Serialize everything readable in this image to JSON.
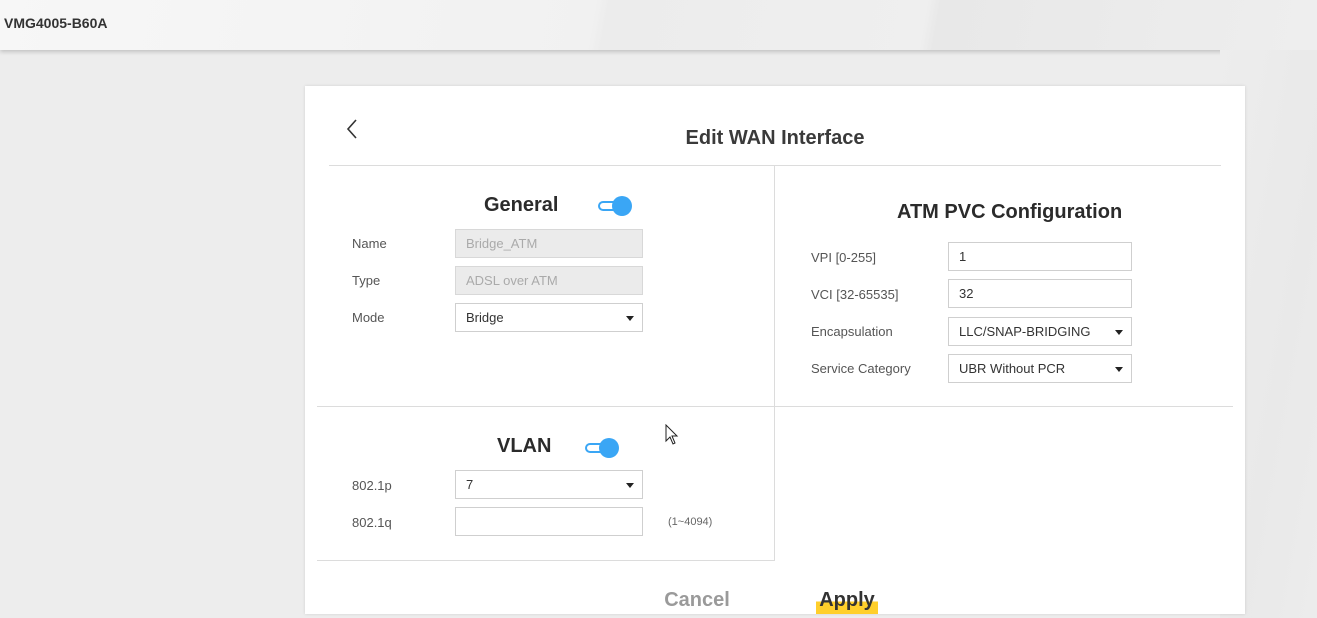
{
  "header": {
    "device_name": "VMG4005-B60A"
  },
  "dialog": {
    "title": "Edit WAN Interface",
    "back_icon": "chevron-left-icon",
    "general": {
      "title": "General",
      "enabled": true,
      "name_label": "Name",
      "name_value": "Bridge_ATM",
      "type_label": "Type",
      "type_value": "ADSL over ATM",
      "mode_label": "Mode",
      "mode_value": "Bridge"
    },
    "atm": {
      "title": "ATM PVC Configuration",
      "vpi_label": "VPI [0-255]",
      "vpi_value": "1",
      "vci_label": "VCI [32-65535]",
      "vci_value": "32",
      "encap_label": "Encapsulation",
      "encap_value": "LLC/SNAP-BRIDGING",
      "service_label": "Service Category",
      "service_value": "UBR Without PCR"
    },
    "vlan": {
      "title": "VLAN",
      "enabled": true,
      "p_label": "802.1p",
      "p_value": "7",
      "q_label": "802.1q",
      "q_value": "",
      "q_hint": "(1~4094)"
    },
    "cancel_label": "Cancel",
    "apply_label": "Apply"
  },
  "colors": {
    "toggle_on": "#3aa6f5",
    "apply_accent": "#ffcf2b"
  }
}
